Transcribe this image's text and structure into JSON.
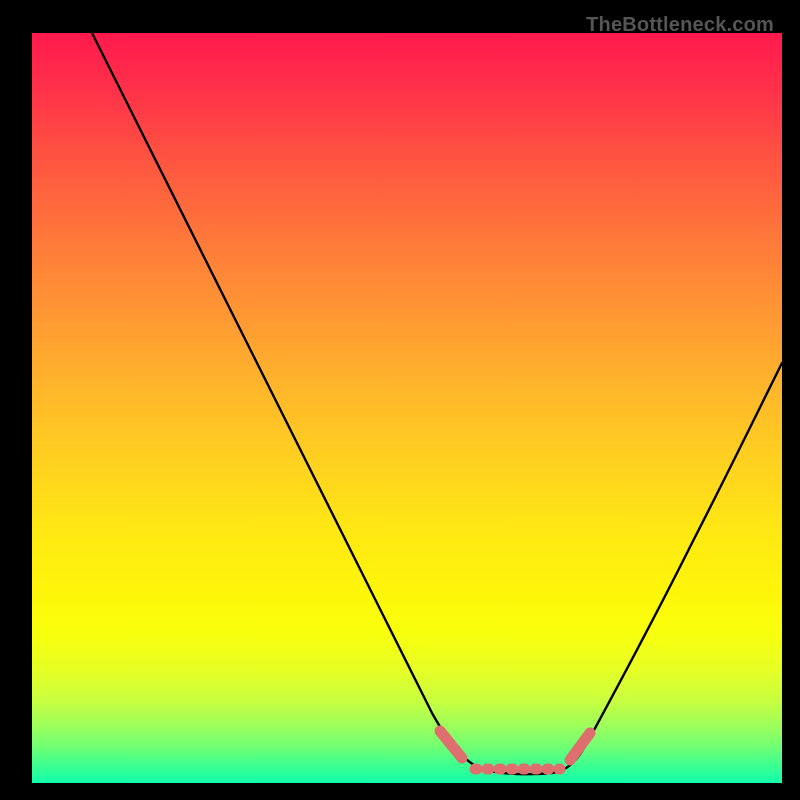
{
  "watermark": "TheBottleneck.com",
  "chart_data": {
    "type": "line",
    "title": "",
    "xlabel": "",
    "ylabel": "",
    "xlim": [
      0,
      100
    ],
    "ylim": [
      0,
      100
    ],
    "grid": false,
    "series": [
      {
        "name": "curve",
        "color": "#000000",
        "x": [
          8,
          15,
          25,
          35,
          45,
          53,
          58,
          60,
          62,
          65,
          68,
          70,
          72,
          75,
          80,
          86,
          92,
          100
        ],
        "y": [
          100,
          88,
          70,
          52,
          33,
          18,
          8,
          3.5,
          2,
          1.3,
          1.2,
          1.3,
          1.8,
          4,
          11,
          22,
          34,
          50
        ]
      },
      {
        "name": "floor-markers",
        "color": "#e26a6a",
        "x_ranges": [
          [
            54.5,
            57.5
          ],
          [
            59,
            70
          ],
          [
            71.5,
            74.5
          ]
        ],
        "y": 1.5
      }
    ],
    "background_gradient": {
      "top": "#ff1a4d",
      "mid": "#ffe714",
      "bottom": "#12ffab"
    }
  }
}
